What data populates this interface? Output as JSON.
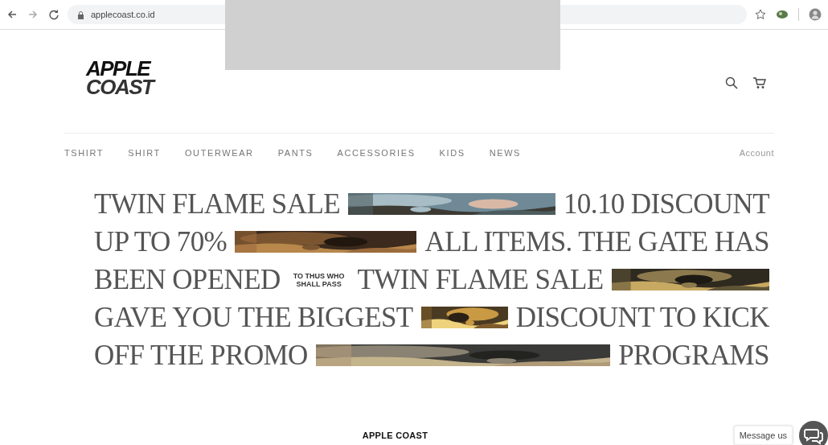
{
  "browser": {
    "url": "applecoast.co.id"
  },
  "redaction": {
    "kind": "block"
  },
  "header": {
    "logo": [
      "APPLE",
      "COAST"
    ]
  },
  "nav": {
    "items": [
      {
        "label": "TSHIRT"
      },
      {
        "label": "SHIRT"
      },
      {
        "label": "OUTERWEAR"
      },
      {
        "label": "PANTS"
      },
      {
        "label": "ACCESSORIES"
      },
      {
        "label": "KIDS"
      },
      {
        "label": "NEWS"
      }
    ],
    "account": "Account"
  },
  "hero": {
    "lines": [
      [
        {
          "kind": "text",
          "text": "TWIN FLAME SALE"
        },
        {
          "kind": "picture"
        },
        {
          "kind": "text",
          "text": "10.10 DISCOUNT"
        }
      ],
      [
        {
          "kind": "text",
          "text": "UP TO 70%"
        },
        {
          "kind": "picture"
        },
        {
          "kind": "text",
          "text": "ALL ITEMS. THE GATE HAS"
        }
      ],
      [
        {
          "kind": "text",
          "text": "BEEN OPENED"
        },
        {
          "kind": "note",
          "text": "TO THUS WHO SHALL PASS"
        },
        {
          "kind": "text",
          "text": "TWIN FLAME SALE"
        },
        {
          "kind": "picture"
        }
      ],
      [
        {
          "kind": "text",
          "text": "GAVE YOU THE BIGGEST"
        },
        {
          "kind": "picture"
        },
        {
          "kind": "text",
          "text": "DISCOUNT TO KICK"
        }
      ],
      [
        {
          "kind": "text",
          "text": "OFF THE PROMO"
        },
        {
          "kind": "picture"
        },
        {
          "kind": "text",
          "text": "PROGRAMS"
        }
      ]
    ]
  },
  "footer": {
    "brand": "APPLE COAST"
  },
  "chat": {
    "label": "Message us"
  }
}
